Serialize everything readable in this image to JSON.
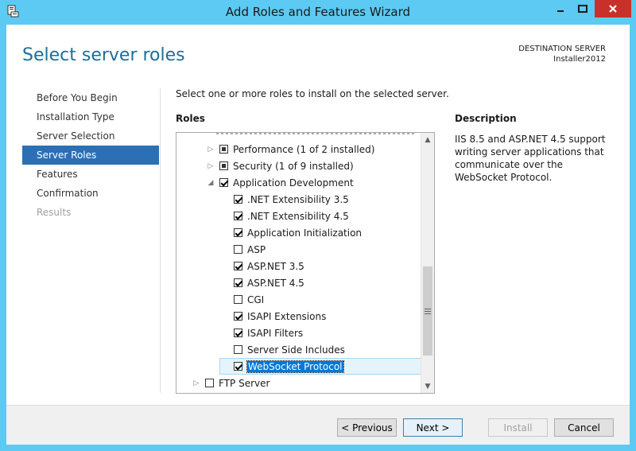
{
  "window": {
    "title": "Add Roles and Features Wizard",
    "icon": "server-manager-icon",
    "accent": "#5ccaf3",
    "close_color": "#c7312a"
  },
  "header": {
    "page_title": "Select server roles",
    "destination_label": "DESTINATION SERVER",
    "destination_value": "Installer2012"
  },
  "nav": {
    "items": [
      {
        "label": "Before You Begin",
        "state": "normal"
      },
      {
        "label": "Installation Type",
        "state": "normal"
      },
      {
        "label": "Server Selection",
        "state": "normal"
      },
      {
        "label": "Server Roles",
        "state": "active"
      },
      {
        "label": "Features",
        "state": "normal"
      },
      {
        "label": "Confirmation",
        "state": "normal"
      },
      {
        "label": "Results",
        "state": "disabled"
      }
    ],
    "active_color": "#2c6fb4"
  },
  "main": {
    "intro": "Select one or more roles to install on the selected server.",
    "roles_label": "Roles",
    "description_label": "Description",
    "description_text": "IIS 8.5 and ASP.NET 4.5 support writing server applications that communicate over the WebSocket Protocol."
  },
  "tree": {
    "rows": [
      {
        "label": "Performance (1 of 2 installed)",
        "state": "partial",
        "expander": "collapsed"
      },
      {
        "label": "Security (1 of 9 installed)",
        "state": "partial",
        "expander": "collapsed"
      },
      {
        "label": "Application Development",
        "state": "checked",
        "expander": "expanded"
      },
      {
        "label": ".NET Extensibility 3.5",
        "state": "checked",
        "expander": "none"
      },
      {
        "label": ".NET Extensibility 4.5",
        "state": "checked",
        "expander": "none"
      },
      {
        "label": "Application Initialization",
        "state": "checked",
        "expander": "none"
      },
      {
        "label": "ASP",
        "state": "unchecked",
        "expander": "none"
      },
      {
        "label": "ASP.NET 3.5",
        "state": "checked",
        "expander": "none"
      },
      {
        "label": "ASP.NET 4.5",
        "state": "checked",
        "expander": "none"
      },
      {
        "label": "CGI",
        "state": "unchecked",
        "expander": "none"
      },
      {
        "label": "ISAPI Extensions",
        "state": "checked",
        "expander": "none"
      },
      {
        "label": "ISAPI Filters",
        "state": "checked",
        "expander": "none"
      },
      {
        "label": "Server Side Includes",
        "state": "unchecked",
        "expander": "none"
      },
      {
        "label": "WebSocket Protocol",
        "state": "checked",
        "expander": "none",
        "selected": true
      },
      {
        "label": "FTP Server",
        "state": "unchecked",
        "expander": "collapsed"
      }
    ]
  },
  "footer": {
    "previous_label": "< Previous",
    "next_label": "Next >",
    "install_label": "Install",
    "cancel_label": "Cancel"
  }
}
